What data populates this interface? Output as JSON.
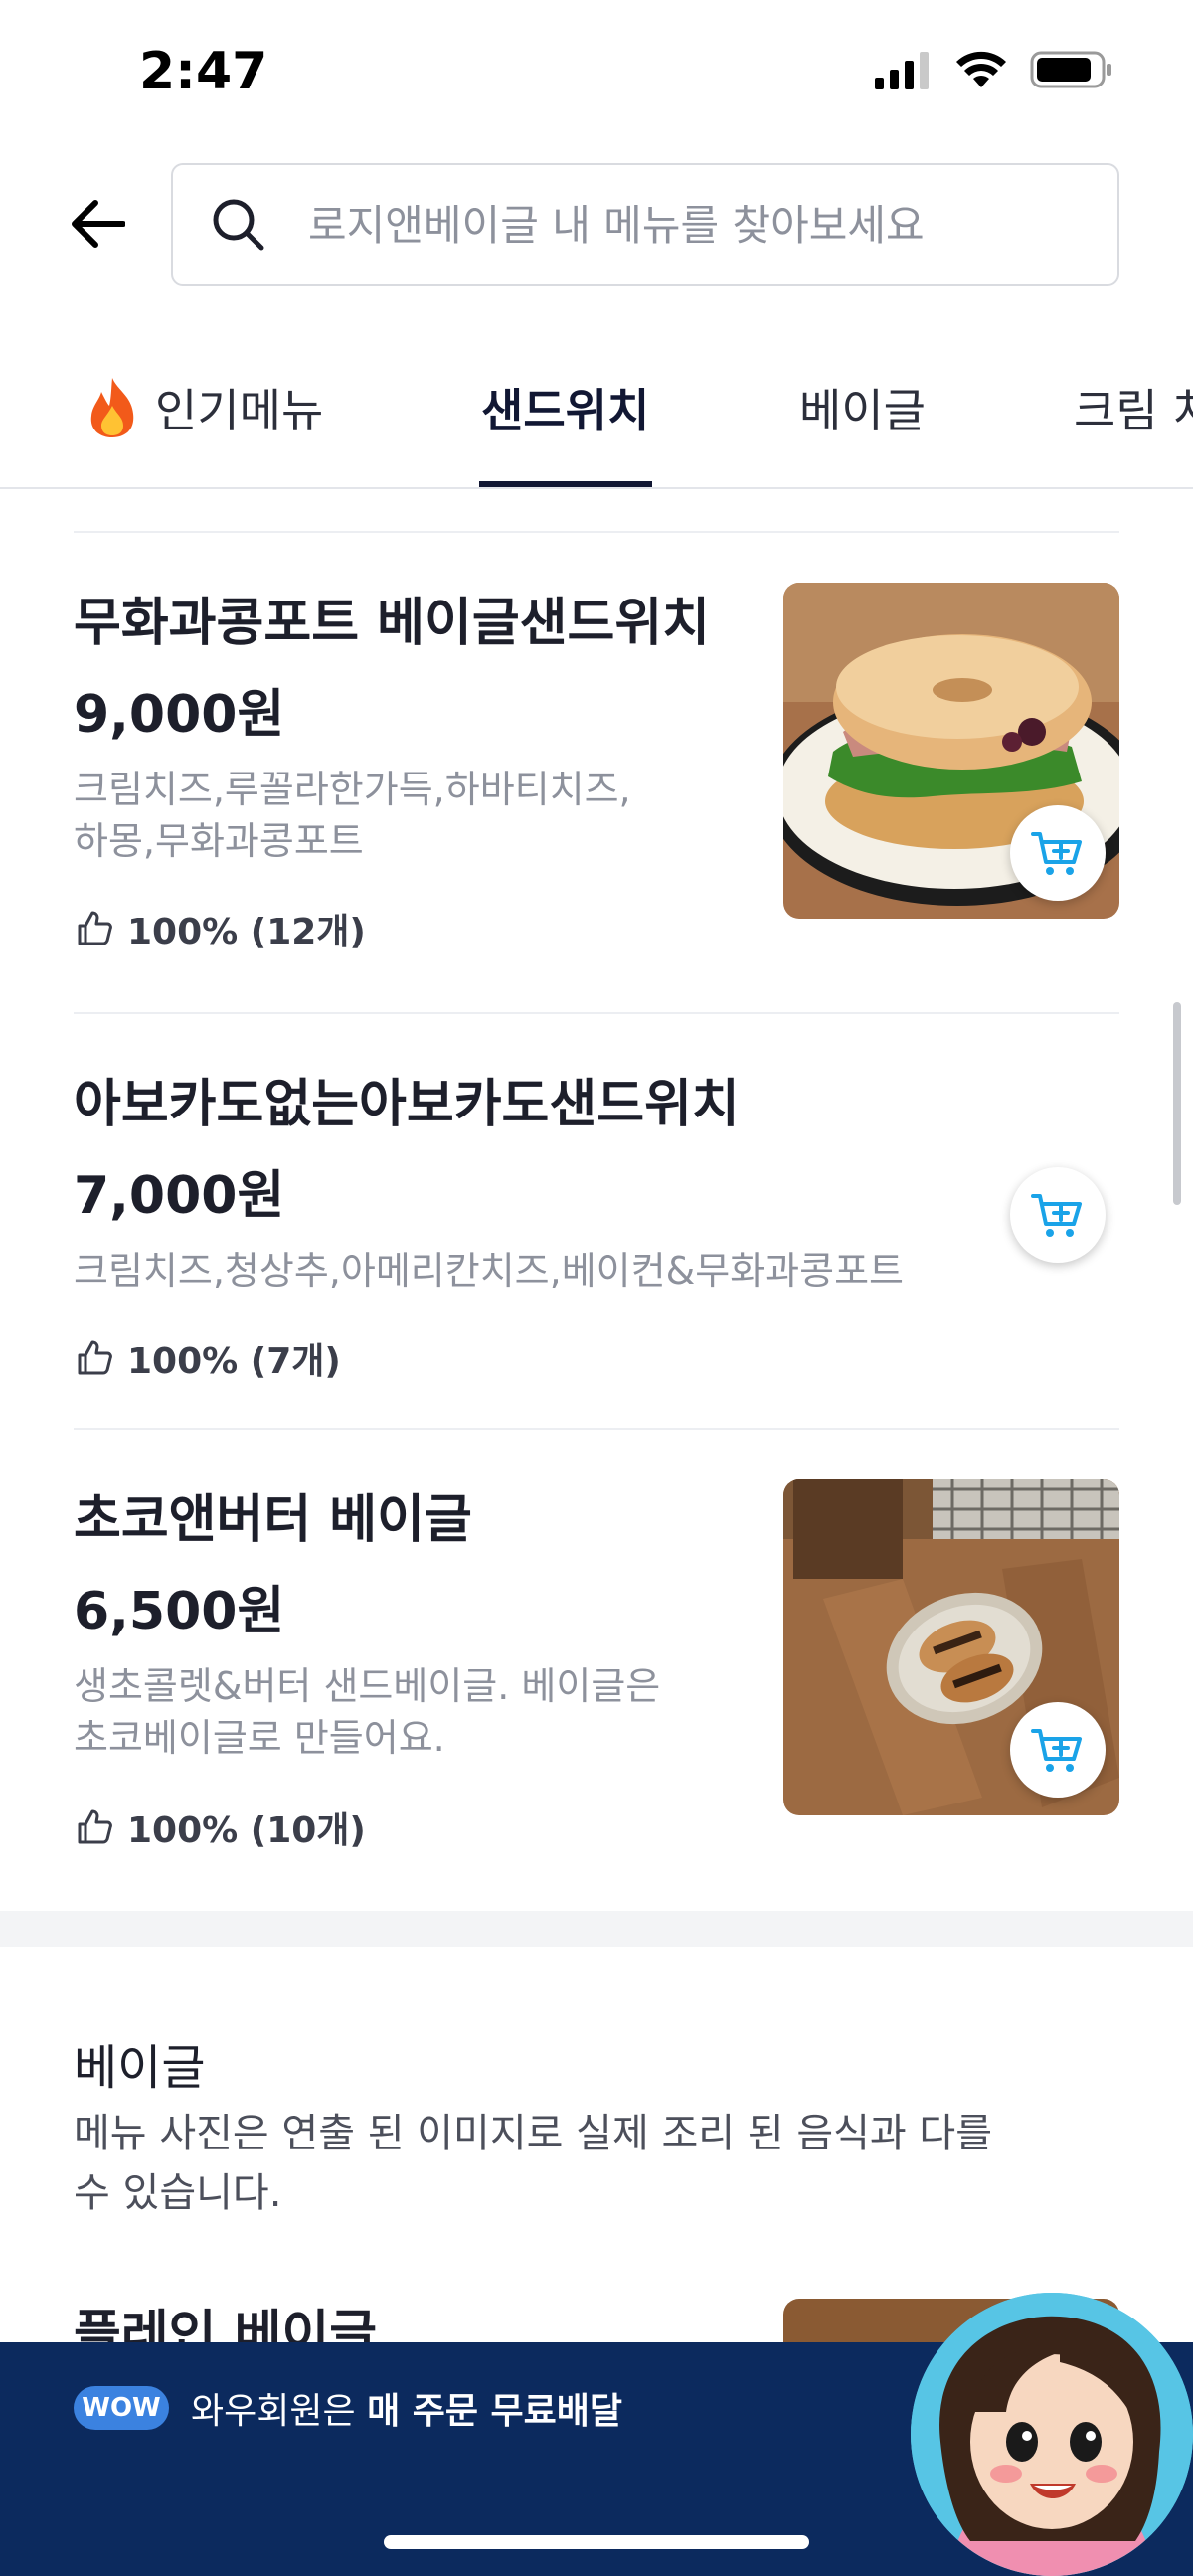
{
  "status_bar": {
    "time": "2:47"
  },
  "search": {
    "placeholder": "로지앤베이글 내 메뉴를 찾아보세요"
  },
  "tabs": [
    {
      "label": "인기메뉴",
      "icon": "fire-icon"
    },
    {
      "label": "샌드위치",
      "active": true
    },
    {
      "label": "베이글"
    },
    {
      "label": "크림 치"
    }
  ],
  "menu_items": [
    {
      "name": "무화과콩포트 베이글샌드위치",
      "price": "9,000원",
      "desc_line1": "크림치즈,루꼴라한가득,하바티치즈,",
      "desc_line2": "하몽,무화과콩포트",
      "like": "100% (12개)"
    },
    {
      "name": "아보카도없는아보카도샌드위치",
      "price": "7,000원",
      "desc_line1": "크림치즈,청상추,아메리칸치즈,베이컨&무화과콩포트",
      "like": "100% (7개)"
    },
    {
      "name": "초코앤버터 베이글",
      "price": "6,500원",
      "desc_line1": "생초콜렛&버터 샌드베이글. 베이글은",
      "desc_line2": "초코베이글로 만들어요.",
      "like": "100% (10개)"
    }
  ],
  "section": {
    "title": "베이글",
    "desc_line1": "메뉴 사진은 연출 된 이미지로 실제 조리 된 음식과 다를",
    "desc_line2": "수 있습니다.",
    "peek_item": "플레인 베이글"
  },
  "wow_banner": {
    "badge": "WOW",
    "text_prefix": "와우회원은",
    "text_bold": "매 주문 무료배달"
  },
  "colors": {
    "accent_cart": "#1aa3e8",
    "banner_bg": "#0c2a5e",
    "tab_active": "#111733",
    "desc_gray": "#8d919c"
  }
}
